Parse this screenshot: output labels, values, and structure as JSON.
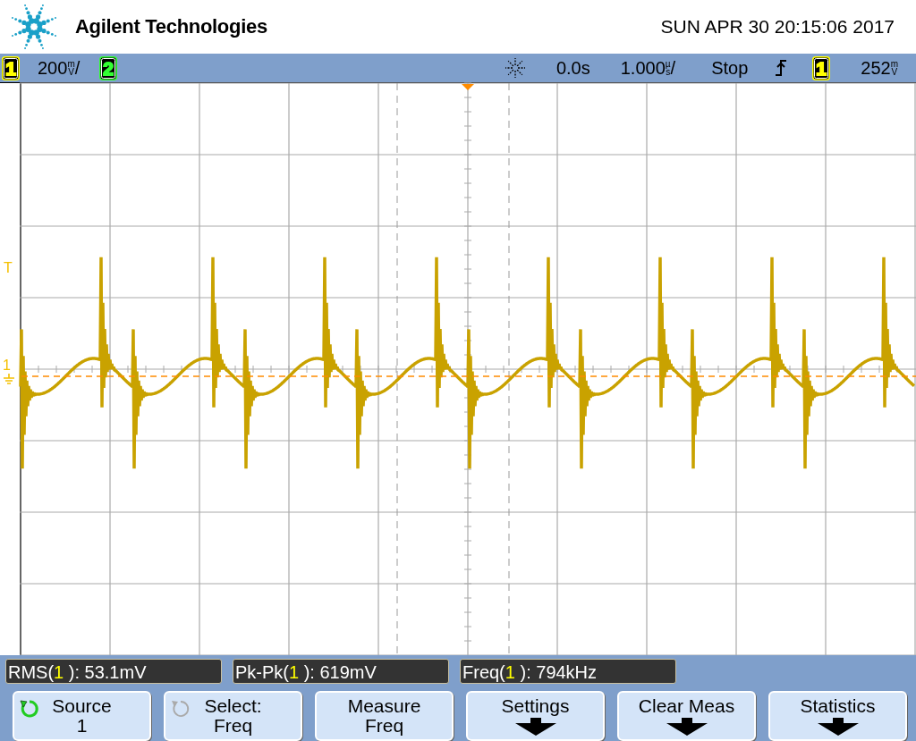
{
  "header": {
    "brand": "Agilent Technologies",
    "datetime": "SUN APR 30 20:15:06 2017"
  },
  "status_bar": [
    {
      "kind": "badge",
      "text": "1",
      "color": "#ffff00"
    },
    {
      "kind": "scale",
      "text": "200",
      "unit_top": "m",
      "unit_bottom": "V",
      "suffix": "/"
    },
    {
      "kind": "badge",
      "text": "2",
      "color": "#33ff33"
    },
    {
      "kind": "acq_icon"
    },
    {
      "kind": "text",
      "text": "0.0s"
    },
    {
      "kind": "scale",
      "text": "1.000",
      "unit_top": "µ",
      "unit_bottom": "s",
      "suffix": "/"
    },
    {
      "kind": "text",
      "text": "Stop"
    },
    {
      "kind": "edge_icon"
    },
    {
      "kind": "badge",
      "text": "1",
      "color": "#ffff00"
    },
    {
      "kind": "scale",
      "text": "252",
      "unit_top": "m",
      "unit_bottom": "V"
    }
  ],
  "markers": {
    "trigger": "T",
    "channel": "1"
  },
  "measurements": [
    {
      "prefix": "RMS(",
      "channel": "1",
      "suffix": " ): 53.1mV"
    },
    {
      "prefix": "Pk-Pk(",
      "channel": "1",
      "suffix": " ): 619mV"
    },
    {
      "prefix": "Freq(",
      "channel": "1",
      "suffix": " ): 794kHz"
    }
  ],
  "softkeys": [
    {
      "kind": "knob",
      "label": "Source",
      "value": "1",
      "enabled": true
    },
    {
      "kind": "knob",
      "label": "Select:",
      "value": "Freq",
      "enabled": false
    },
    {
      "kind": "plain",
      "label": "Measure",
      "value": "Freq"
    },
    {
      "kind": "menu",
      "label": "Settings"
    },
    {
      "kind": "menu",
      "label": "Clear Meas"
    },
    {
      "kind": "menu",
      "label": "Statistics"
    }
  ]
}
